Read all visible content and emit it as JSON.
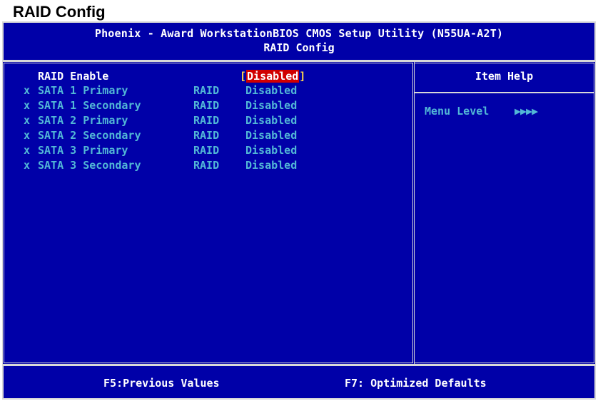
{
  "document_title": "RAID Config",
  "header": {
    "line1": "Phoenix - Award WorkstationBIOS CMOS Setup Utility (N55UA-A2T)",
    "line2": "RAID Config"
  },
  "raid_enable": {
    "label": "RAID Enable",
    "bracket_open": "[",
    "value": "Disabled",
    "bracket_close": "]"
  },
  "items": [
    {
      "mark": "x",
      "label": "SATA 1 Primary",
      "mode": "RAID",
      "value": "Disabled"
    },
    {
      "mark": "x",
      "label": "SATA 1 Secondary",
      "mode": "RAID",
      "value": "Disabled"
    },
    {
      "mark": "x",
      "label": "SATA 2 Primary",
      "mode": "RAID",
      "value": "Disabled"
    },
    {
      "mark": "x",
      "label": "SATA 2 Secondary",
      "mode": "RAID",
      "value": "Disabled"
    },
    {
      "mark": "x",
      "label": "SATA 3 Primary",
      "mode": "RAID",
      "value": "Disabled"
    },
    {
      "mark": "x",
      "label": "SATA 3 Secondary",
      "mode": "RAID",
      "value": "Disabled"
    }
  ],
  "help": {
    "title": "Item Help",
    "menu_level_label": "Menu Level",
    "menu_level_arrows": "▶▶▶▶"
  },
  "footer": {
    "f5": "F5:Previous Values",
    "f7": "F7: Optimized Defaults"
  },
  "colors": {
    "background": "#0000a8",
    "text_active": "#ffffff",
    "text_disabled": "#52b7d6",
    "selection": "#d00000",
    "bracket": "#ffd84a"
  }
}
